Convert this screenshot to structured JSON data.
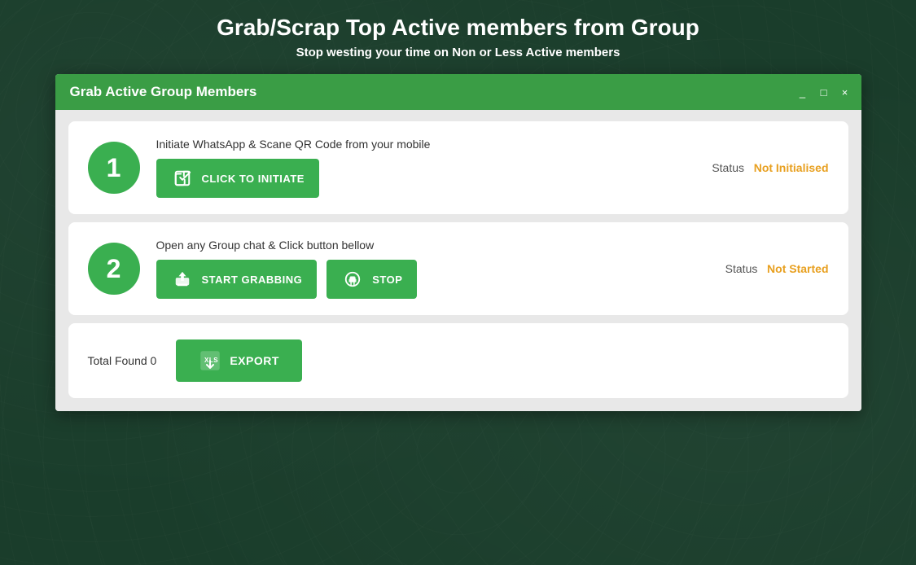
{
  "page": {
    "title": "Grab/Scrap Top Active members from Group",
    "subtitle": "Stop westing your time on Non or Less Active members"
  },
  "window": {
    "titlebar_title": "Grab Active Group Members",
    "controls": {
      "minimize": "_",
      "maximize": "□",
      "close": "×"
    }
  },
  "step1": {
    "number": "1",
    "instruction": "Initiate WhatsApp & Scane QR Code from your mobile",
    "button_label": "CLICK TO INITIATE",
    "status_label": "Status",
    "status_value": "Not Initialised"
  },
  "step2": {
    "number": "2",
    "instruction": "Open any Group chat & Click button bellow",
    "start_button_label": "START GRABBING",
    "stop_button_label": "STOP",
    "status_label": "Status",
    "status_value": "Not Started"
  },
  "export": {
    "total_label": "Total Found 0",
    "button_label": "EXPORT"
  }
}
